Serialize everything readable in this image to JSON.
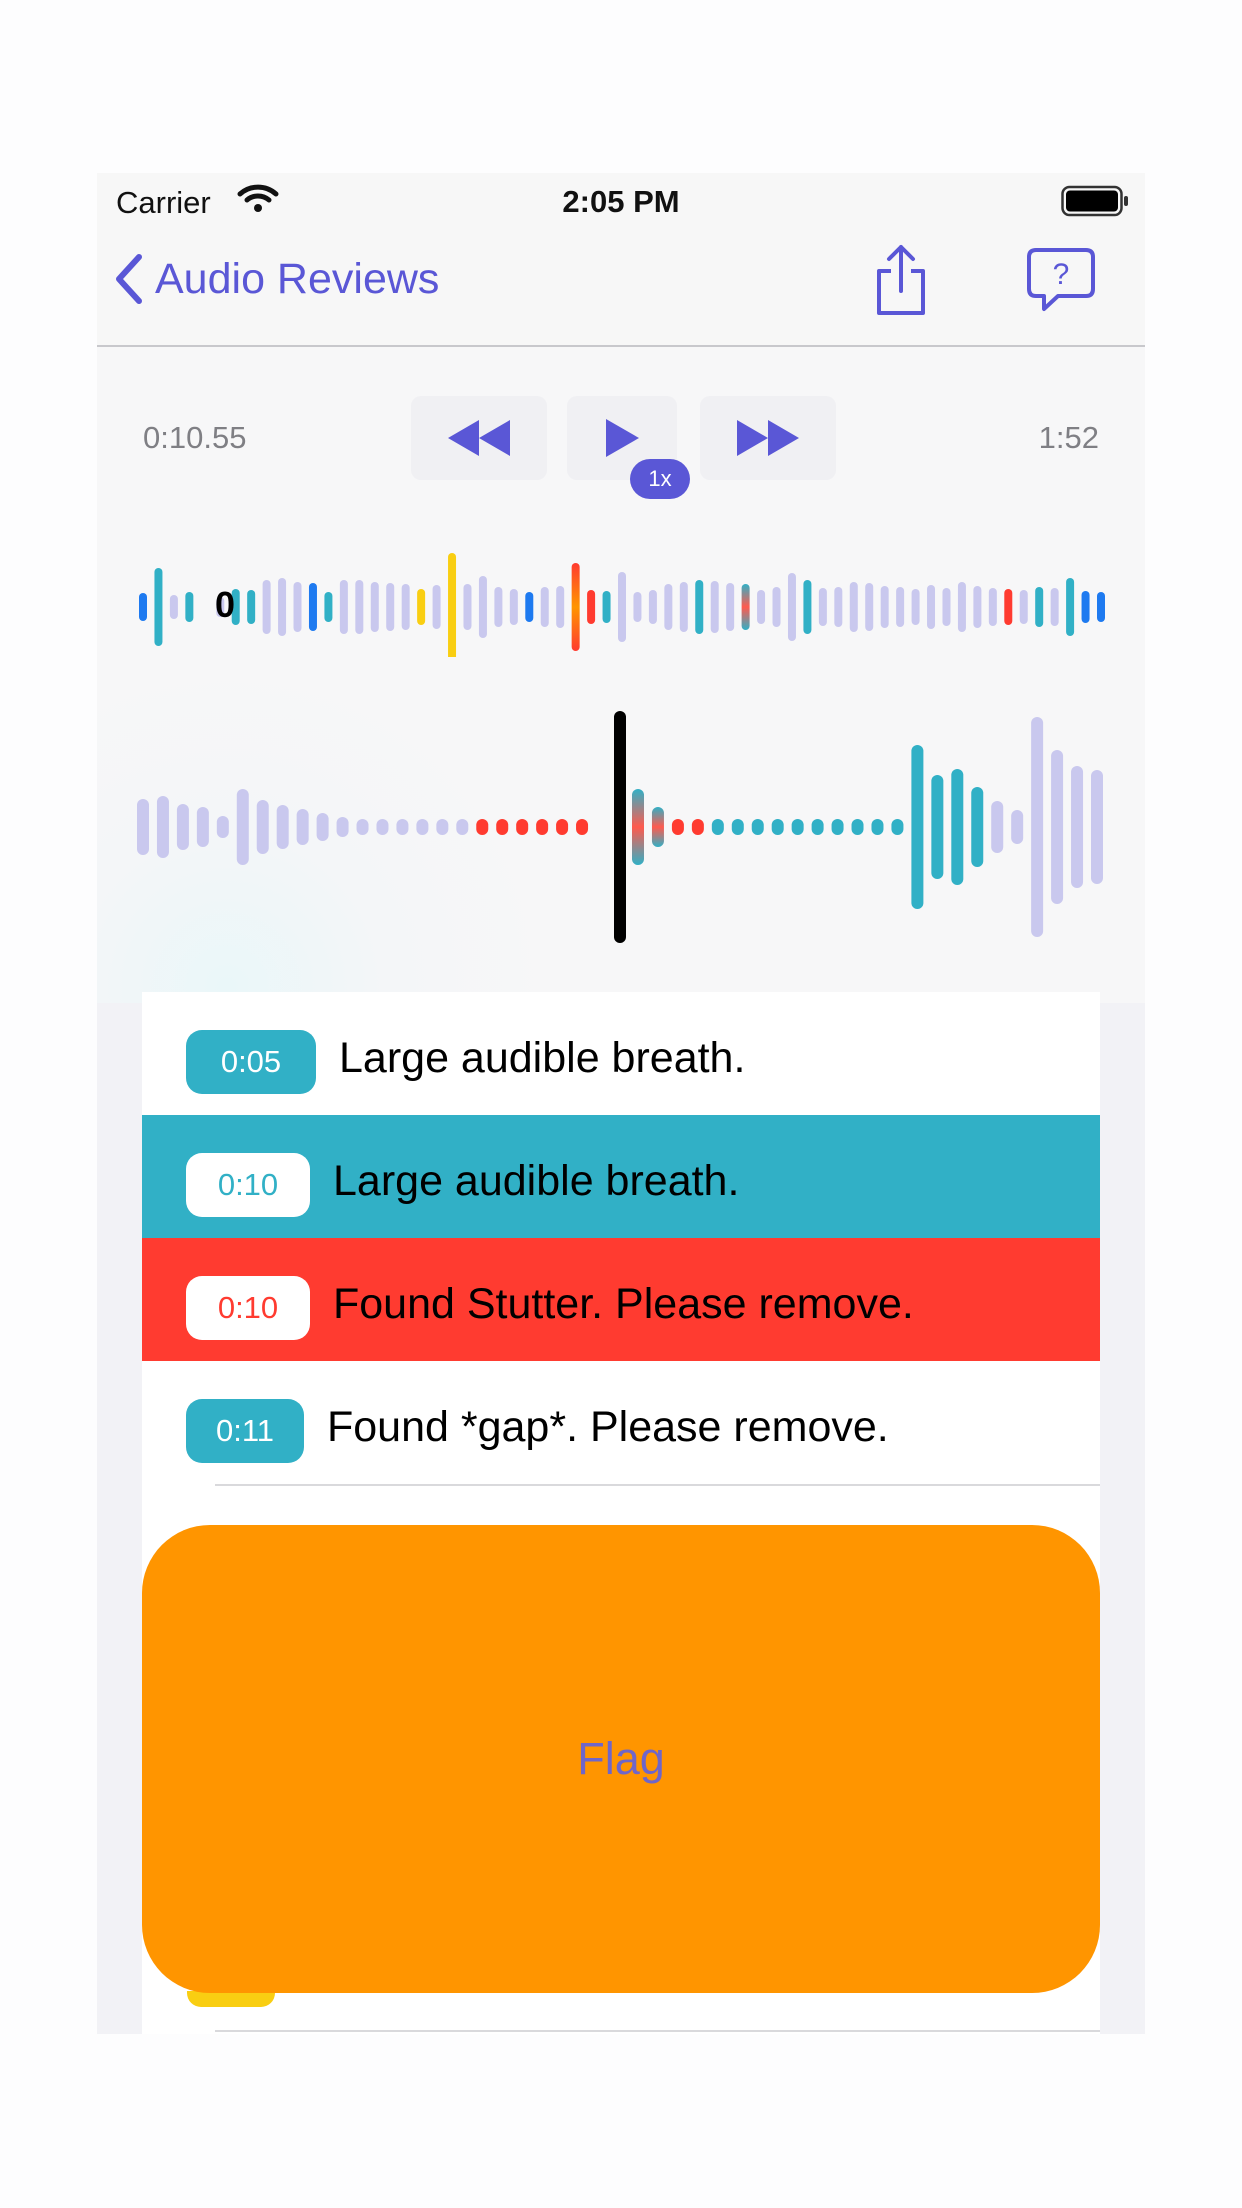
{
  "status_bar": {
    "carrier": "Carrier",
    "time": "2:05 PM"
  },
  "nav": {
    "back_label": "Audio Reviews",
    "share_icon": "share-icon",
    "help_icon": "help-bubble-icon"
  },
  "player": {
    "elapsed": "0:10.55",
    "duration": "1:52",
    "speed": "1x",
    "marker_label": "0",
    "colors": {
      "accent": "#5A57D6",
      "teal": "#31B0C6",
      "red": "#FF3B30",
      "yellow": "#F9CE12",
      "blue": "#1E7AF0",
      "lavender": "#C9C8EE"
    }
  },
  "markers": [
    {
      "time": "0:05",
      "text": "Large audible breath.",
      "style": "teal"
    },
    {
      "time": "0:10",
      "text": "Large audible breath.",
      "style": "selected-teal"
    },
    {
      "time": "0:10",
      "text": "Found Stutter.  Please remove.",
      "style": "selected-red"
    },
    {
      "time": "0:11",
      "text": "Found *gap*.  Please remove.",
      "style": "teal"
    }
  ],
  "flag_button": {
    "label": "Flag",
    "color": "#FF9500"
  }
}
